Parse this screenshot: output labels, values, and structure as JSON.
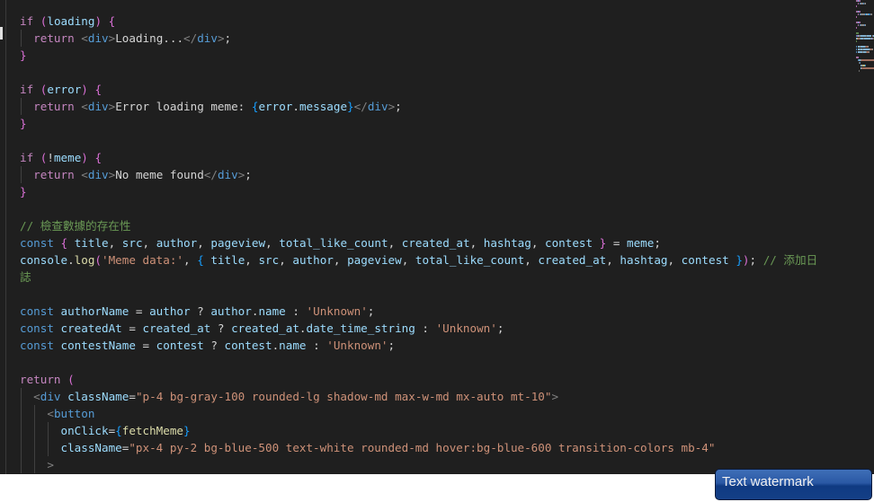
{
  "editor": {
    "lines": [
      {
        "indent": 0,
        "tokens": [
          [
            "kw",
            "if"
          ],
          [
            "plain",
            " "
          ],
          [
            "b1",
            "("
          ],
          [
            "var",
            "loading"
          ],
          [
            "b1",
            ")"
          ],
          [
            "plain",
            " "
          ],
          [
            "b1",
            "{"
          ]
        ]
      },
      {
        "indent": 1,
        "tokens": [
          [
            "kw",
            "return"
          ],
          [
            "plain",
            " "
          ],
          [
            "tagp",
            "<"
          ],
          [
            "tag",
            "div"
          ],
          [
            "tagp",
            ">"
          ],
          [
            "plain",
            "Loading..."
          ],
          [
            "tagp",
            "</"
          ],
          [
            "tag",
            "div"
          ],
          [
            "tagp",
            ">"
          ],
          [
            "plain",
            ";"
          ]
        ]
      },
      {
        "indent": 0,
        "tokens": [
          [
            "b1",
            "}"
          ]
        ]
      },
      {
        "indent": 0,
        "tokens": []
      },
      {
        "indent": 0,
        "tokens": [
          [
            "kw",
            "if"
          ],
          [
            "plain",
            " "
          ],
          [
            "b1",
            "("
          ],
          [
            "var",
            "error"
          ],
          [
            "b1",
            ")"
          ],
          [
            "plain",
            " "
          ],
          [
            "b1",
            "{"
          ]
        ]
      },
      {
        "indent": 1,
        "tokens": [
          [
            "kw",
            "return"
          ],
          [
            "plain",
            " "
          ],
          [
            "tagp",
            "<"
          ],
          [
            "tag",
            "div"
          ],
          [
            "tagp",
            ">"
          ],
          [
            "plain",
            "Error loading meme: "
          ],
          [
            "b2",
            "{"
          ],
          [
            "var",
            "error"
          ],
          [
            "plain",
            "."
          ],
          [
            "var",
            "message"
          ],
          [
            "b2",
            "}"
          ],
          [
            "tagp",
            "</"
          ],
          [
            "tag",
            "div"
          ],
          [
            "tagp",
            ">"
          ],
          [
            "plain",
            ";"
          ]
        ]
      },
      {
        "indent": 0,
        "tokens": [
          [
            "b1",
            "}"
          ]
        ]
      },
      {
        "indent": 0,
        "tokens": []
      },
      {
        "indent": 0,
        "tokens": [
          [
            "kw",
            "if"
          ],
          [
            "plain",
            " "
          ],
          [
            "b1",
            "("
          ],
          [
            "plain",
            "!"
          ],
          [
            "var",
            "meme"
          ],
          [
            "b1",
            ")"
          ],
          [
            "plain",
            " "
          ],
          [
            "b1",
            "{"
          ]
        ]
      },
      {
        "indent": 1,
        "tokens": [
          [
            "kw",
            "return"
          ],
          [
            "plain",
            " "
          ],
          [
            "tagp",
            "<"
          ],
          [
            "tag",
            "div"
          ],
          [
            "tagp",
            ">"
          ],
          [
            "plain",
            "No meme found"
          ],
          [
            "tagp",
            "</"
          ],
          [
            "tag",
            "div"
          ],
          [
            "tagp",
            ">"
          ],
          [
            "plain",
            ";"
          ]
        ]
      },
      {
        "indent": 0,
        "tokens": [
          [
            "b1",
            "}"
          ]
        ]
      },
      {
        "indent": 0,
        "tokens": []
      },
      {
        "indent": 0,
        "tokens": [
          [
            "cm",
            "// 檢查數據的存在性"
          ]
        ]
      },
      {
        "indent": 0,
        "tokens": [
          [
            "st",
            "const"
          ],
          [
            "plain",
            " "
          ],
          [
            "b1",
            "{"
          ],
          [
            "plain",
            " "
          ],
          [
            "var",
            "title"
          ],
          [
            "plain",
            ", "
          ],
          [
            "var",
            "src"
          ],
          [
            "plain",
            ", "
          ],
          [
            "var",
            "author"
          ],
          [
            "plain",
            ", "
          ],
          [
            "var",
            "pageview"
          ],
          [
            "plain",
            ", "
          ],
          [
            "var",
            "total_like_count"
          ],
          [
            "plain",
            ", "
          ],
          [
            "var",
            "created_at"
          ],
          [
            "plain",
            ", "
          ],
          [
            "var",
            "hashtag"
          ],
          [
            "plain",
            ", "
          ],
          [
            "var",
            "contest"
          ],
          [
            "plain",
            " "
          ],
          [
            "b1",
            "}"
          ],
          [
            "plain",
            " = "
          ],
          [
            "var",
            "meme"
          ],
          [
            "plain",
            ";"
          ]
        ]
      },
      {
        "indent": 0,
        "tokens": [
          [
            "var",
            "console"
          ],
          [
            "plain",
            "."
          ],
          [
            "fn",
            "log"
          ],
          [
            "b1",
            "("
          ],
          [
            "str",
            "'Meme data:'"
          ],
          [
            "plain",
            ", "
          ],
          [
            "b2",
            "{"
          ],
          [
            "plain",
            " "
          ],
          [
            "var",
            "title"
          ],
          [
            "plain",
            ", "
          ],
          [
            "var",
            "src"
          ],
          [
            "plain",
            ", "
          ],
          [
            "var",
            "author"
          ],
          [
            "plain",
            ", "
          ],
          [
            "var",
            "pageview"
          ],
          [
            "plain",
            ", "
          ],
          [
            "var",
            "total_like_count"
          ],
          [
            "plain",
            ", "
          ],
          [
            "var",
            "created_at"
          ],
          [
            "plain",
            ", "
          ],
          [
            "var",
            "hashtag"
          ],
          [
            "plain",
            ", "
          ],
          [
            "var",
            "contest"
          ],
          [
            "plain",
            " "
          ],
          [
            "b2",
            "}"
          ],
          [
            "b1",
            ")"
          ],
          [
            "plain",
            "; "
          ],
          [
            "cm",
            "// 添加日"
          ]
        ]
      },
      {
        "indent": 0,
        "tokens": [
          [
            "cm",
            "誌"
          ]
        ]
      },
      {
        "indent": 0,
        "tokens": []
      },
      {
        "indent": 0,
        "tokens": [
          [
            "st",
            "const"
          ],
          [
            "plain",
            " "
          ],
          [
            "var",
            "authorName"
          ],
          [
            "plain",
            " = "
          ],
          [
            "var",
            "author"
          ],
          [
            "plain",
            " ? "
          ],
          [
            "var",
            "author"
          ],
          [
            "plain",
            "."
          ],
          [
            "var",
            "name"
          ],
          [
            "plain",
            " : "
          ],
          [
            "str",
            "'Unknown'"
          ],
          [
            "plain",
            ";"
          ]
        ]
      },
      {
        "indent": 0,
        "tokens": [
          [
            "st",
            "const"
          ],
          [
            "plain",
            " "
          ],
          [
            "var",
            "createdAt"
          ],
          [
            "plain",
            " = "
          ],
          [
            "var",
            "created_at"
          ],
          [
            "plain",
            " ? "
          ],
          [
            "var",
            "created_at"
          ],
          [
            "plain",
            "."
          ],
          [
            "var",
            "date_time_string"
          ],
          [
            "plain",
            " : "
          ],
          [
            "str",
            "'Unknown'"
          ],
          [
            "plain",
            ";"
          ]
        ]
      },
      {
        "indent": 0,
        "tokens": [
          [
            "st",
            "const"
          ],
          [
            "plain",
            " "
          ],
          [
            "var",
            "contestName"
          ],
          [
            "plain",
            " = "
          ],
          [
            "var",
            "contest"
          ],
          [
            "plain",
            " ? "
          ],
          [
            "var",
            "contest"
          ],
          [
            "plain",
            "."
          ],
          [
            "var",
            "name"
          ],
          [
            "plain",
            " : "
          ],
          [
            "str",
            "'Unknown'"
          ],
          [
            "plain",
            ";"
          ]
        ]
      },
      {
        "indent": 0,
        "tokens": []
      },
      {
        "indent": 0,
        "tokens": [
          [
            "kw",
            "return"
          ],
          [
            "plain",
            " "
          ],
          [
            "b1",
            "("
          ]
        ]
      },
      {
        "indent": 1,
        "tokens": [
          [
            "tagp",
            "<"
          ],
          [
            "tag",
            "div"
          ],
          [
            "plain",
            " "
          ],
          [
            "var",
            "className"
          ],
          [
            "plain",
            "="
          ],
          [
            "str",
            "\"p-4 bg-gray-100 rounded-lg shadow-md max-w-md mx-auto mt-10\""
          ],
          [
            "tagp",
            ">"
          ]
        ]
      },
      {
        "indent": 2,
        "tokens": [
          [
            "tagp",
            "<"
          ],
          [
            "tag",
            "button"
          ]
        ]
      },
      {
        "indent": 3,
        "tokens": [
          [
            "var",
            "onClick"
          ],
          [
            "plain",
            "="
          ],
          [
            "b2",
            "{"
          ],
          [
            "fn",
            "fetchMeme"
          ],
          [
            "b2",
            "}"
          ]
        ]
      },
      {
        "indent": 3,
        "tokens": [
          [
            "var",
            "className"
          ],
          [
            "plain",
            "="
          ],
          [
            "str",
            "\"px-4 py-2 bg-blue-500 text-white rounded-md hover:bg-blue-600 transition-colors mb-4\""
          ]
        ]
      },
      {
        "indent": 2,
        "tokens": [
          [
            "tagp",
            ">"
          ]
        ]
      }
    ]
  },
  "watermark": {
    "text": "Text watermark"
  }
}
